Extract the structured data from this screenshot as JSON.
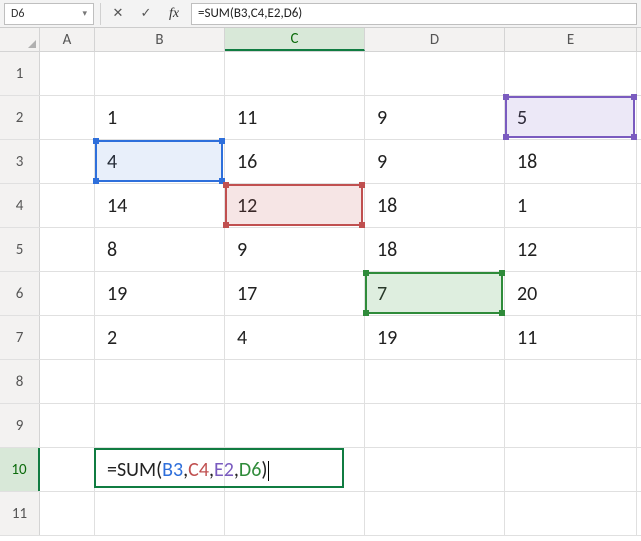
{
  "namebox": "D6",
  "formula_bar": "=SUM(B3,C4,E2,D6)",
  "columns": [
    "A",
    "B",
    "C",
    "D",
    "E"
  ],
  "rows": [
    "1",
    "2",
    "3",
    "4",
    "5",
    "6",
    "7",
    "8",
    "9",
    "10",
    "11"
  ],
  "active_row": "10",
  "active_col": "C",
  "cells": {
    "B2": "1",
    "C2": "11",
    "D2": "9",
    "E2": "5",
    "B3": "4",
    "C3": "16",
    "D3": "9",
    "E3": "18",
    "B4": "14",
    "C4": "12",
    "D4": "18",
    "E4": "1",
    "B5": "8",
    "C5": "9",
    "D5": "18",
    "E5": "12",
    "B6": "19",
    "C6": "17",
    "D6": "7",
    "E6": "20",
    "B7": "2",
    "C7": "4",
    "D7": "19",
    "E7": "11"
  },
  "editing_cell": "B10",
  "editing_formula": {
    "prefix": "=SUM(",
    "refs": [
      {
        "text": "B3",
        "cls": "ref-blue"
      },
      {
        "text": "C4",
        "cls": "ref-red"
      },
      {
        "text": "E2",
        "cls": "ref-purple"
      },
      {
        "text": "D6",
        "cls": "ref-green"
      }
    ],
    "sep": ",",
    "suffix": ")"
  },
  "highlights": [
    {
      "ref": "B3",
      "cls": "hl-blue"
    },
    {
      "ref": "C4",
      "cls": "hl-red"
    },
    {
      "ref": "E2",
      "cls": "hl-purple"
    },
    {
      "ref": "D6",
      "cls": "hl-green"
    }
  ],
  "icons": {
    "cancel": "✕",
    "confirm": "✓",
    "fx": "fx",
    "dropdown": "▾"
  },
  "chart_data": {
    "type": "table",
    "columns": [
      "B",
      "C",
      "D",
      "E"
    ],
    "rows": [
      "2",
      "3",
      "4",
      "5",
      "6",
      "7"
    ],
    "data": [
      [
        1,
        11,
        9,
        5
      ],
      [
        4,
        16,
        9,
        18
      ],
      [
        14,
        12,
        18,
        1
      ],
      [
        8,
        9,
        18,
        12
      ],
      [
        19,
        17,
        7,
        20
      ],
      [
        2,
        4,
        19,
        11
      ]
    ],
    "formula_cell": "B10",
    "formula": "=SUM(B3,C4,E2,D6)",
    "referenced_cells": [
      "B3",
      "C4",
      "E2",
      "D6"
    ]
  }
}
